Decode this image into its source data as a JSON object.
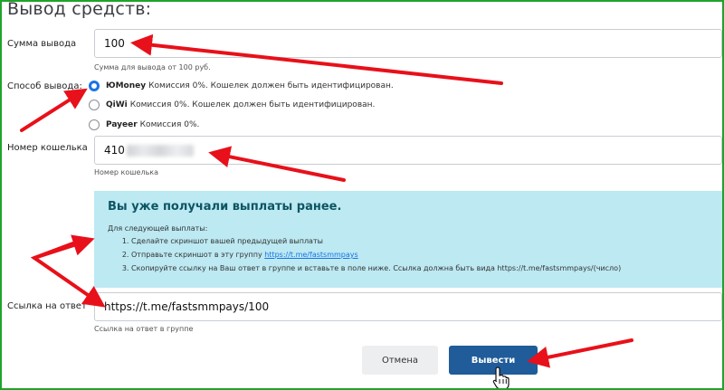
{
  "page": {
    "title": "Вывод средств:"
  },
  "amount": {
    "label": "Сумма вывода",
    "value": "100",
    "help": "Сумма для вывода от 100 руб."
  },
  "method": {
    "label": "Способ вывода:",
    "options": [
      {
        "name": "ЮMoney",
        "desc": "Комиссия 0%. Кошелек должен быть идентифицирован.",
        "checked": true
      },
      {
        "name": "QiWi",
        "desc": "Комиссия 0%. Кошелек должен быть идентифицирован.",
        "checked": false
      },
      {
        "name": "Payeer",
        "desc": "Комиссия 0%.",
        "checked": false
      }
    ]
  },
  "wallet": {
    "label": "Номер кошелька",
    "value": "410",
    "help": "Номер кошелька"
  },
  "notice": {
    "title": "Вы уже получали выплаты ранее.",
    "intro": "Для следующей выплаты:",
    "step1": "Сделайте скриншот вашей предыдущей выплаты",
    "step2_text": "Отправьте скриншот в эту группу",
    "step2_link": "https://t.me/fastsmmpays",
    "step3": "Скопируйте ссылку на Ваш ответ в группе и вставьте в поле ниже. Ссылка должна быть вида https://t.me/fastsmmpays/(число)"
  },
  "reply_link": {
    "label": "Ссылка на ответ",
    "value": "https://t.me/fastsmmpays/100",
    "help": "Ссылка на ответ в группе"
  },
  "actions": {
    "cancel": "Отмена",
    "submit": "Вывести"
  },
  "colors": {
    "accent": "#1a73e8",
    "submit_bg": "#1f5c99",
    "notice_bg": "#bce9f2",
    "annotation": "#e8101a",
    "frame": "#1fa32a"
  }
}
